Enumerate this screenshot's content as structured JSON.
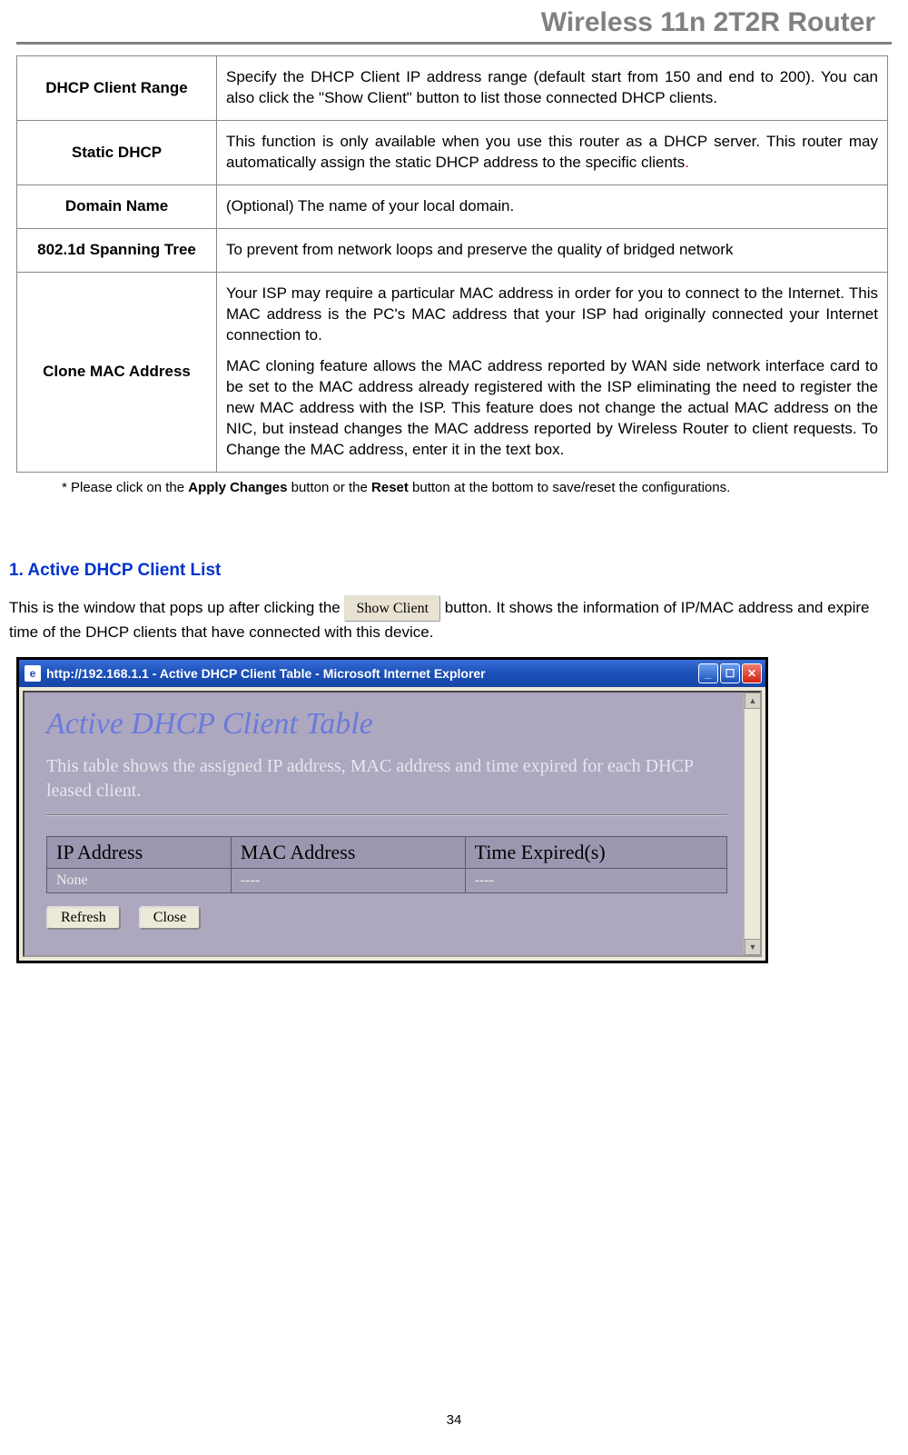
{
  "header": {
    "title": "Wireless 11n 2T2R Router"
  },
  "config_table": [
    {
      "name": "DHCP Client Range",
      "desc": "Specify the DHCP Client IP address range (default start from 150 and end to 200). You can also click the \"Show Client\" button to list those connected DHCP clients."
    },
    {
      "name": "Static DHCP",
      "desc": "This function is only available when you use this router as a DHCP server. This router may automatically assign the static DHCP address to the specific clients"
    },
    {
      "name": "Domain Name",
      "desc": "(Optional) The name of your local domain."
    },
    {
      "name": "802.1d Spanning Tree",
      "desc": "To prevent from network loops and preserve the quality of bridged network"
    },
    {
      "name": "Clone MAC Address",
      "desc_p1": "Your ISP may require a particular MAC address in order for you to connect to the Internet. This MAC address is the PC's MAC address that your ISP had originally connected your Internet connection to.",
      "desc_p2": "MAC cloning feature allows the MAC address reported by WAN side network interface card to be set to the MAC address already registered with the ISP eliminating the need to register the new MAC address with the ISP. This feature does not change the actual MAC address on the NIC, but instead changes the MAC address reported by Wireless Router to client requests. To Change the MAC address, enter it in the text box."
    }
  ],
  "note": {
    "prefix": "* Please click on the ",
    "btn1": "Apply Changes",
    "mid": " button or the ",
    "btn2": "Reset",
    "suffix": " button at the bottom to save/reset the configurations."
  },
  "section1": {
    "heading": "1. Active DHCP Client List",
    "body_pre": "This is the window that pops up after clicking the ",
    "show_client_btn": "Show Client",
    "body_post": " button. It shows the information of IP/MAC address and expire time of the DHCP clients that have connected with this device."
  },
  "popup": {
    "titlebar": "http://192.168.1.1 - Active DHCP Client Table - Microsoft Internet Explorer",
    "heading": "Active DHCP Client Table",
    "desc": "This table shows the assigned IP address, MAC address and time expired for each DHCP leased client.",
    "table": {
      "headers": [
        "IP Address",
        "MAC Address",
        "Time Expired(s)"
      ],
      "rows": [
        [
          "None",
          "----",
          "----"
        ]
      ]
    },
    "buttons": {
      "refresh": "Refresh",
      "close": "Close"
    }
  },
  "page_number": "34"
}
